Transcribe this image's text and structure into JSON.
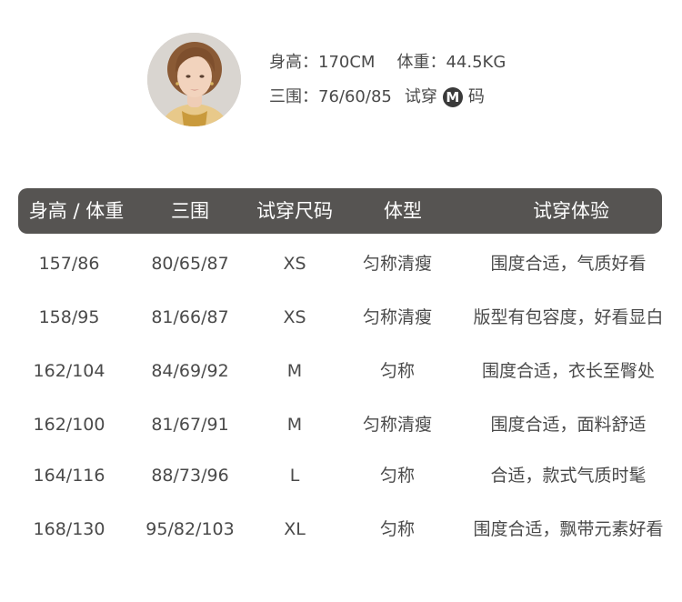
{
  "model": {
    "height_label": "身高：",
    "height_value": "170CM",
    "weight_label": "体重：",
    "weight_value": "44.5KG",
    "measure_label": "三围：",
    "measure_value": "76/60/85",
    "tryon_label": "试穿",
    "tryon_size": "M",
    "tryon_unit": "码"
  },
  "table": {
    "headers": [
      "身高 / 体重",
      "三围",
      "试穿尺码",
      "体型",
      "试穿体验"
    ],
    "rows": [
      [
        "157/86",
        "80/65/87",
        "XS",
        "匀称清瘦",
        "围度合适，气质好看"
      ],
      [
        "158/95",
        "81/66/87",
        "XS",
        "匀称清瘦",
        "版型有包容度，好看显白"
      ],
      [
        "162/104",
        "84/69/92",
        "M",
        "匀称",
        "围度合适，衣长至臀处"
      ],
      [
        "162/100",
        "81/67/91",
        "M",
        "匀称清瘦",
        "围度合适，面料舒适"
      ],
      [
        "164/116",
        "88/73/96",
        "L",
        "匀称",
        "合适，款式气质时髦"
      ],
      [
        "168/130",
        "95/82/103",
        "XL",
        "匀称",
        "围度合适，飘带元素好看"
      ]
    ]
  }
}
